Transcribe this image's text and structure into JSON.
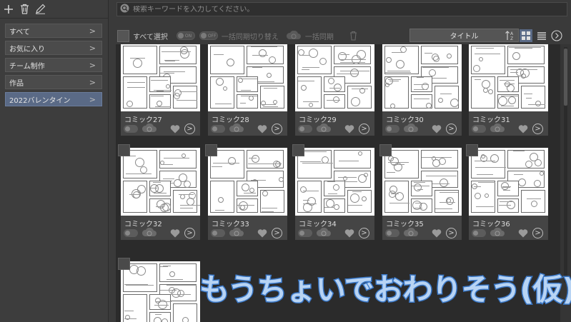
{
  "left_toolbar": {
    "icons": [
      "add-icon",
      "trash-icon",
      "pencil-icon"
    ]
  },
  "filters": [
    {
      "label": "すべて",
      "active": false
    },
    {
      "label": "お気に入り",
      "active": false
    },
    {
      "label": "チーム制作",
      "active": false
    },
    {
      "label": "作品",
      "active": false
    },
    {
      "label": "2022バレンタイン",
      "active": true
    }
  ],
  "filter_chevron": ">",
  "search": {
    "placeholder": "検索キーワードを入力してください。",
    "value": ""
  },
  "toolbar": {
    "select_all": "すべて選択",
    "toggle_on": "ON",
    "toggle_off": "OFF",
    "sync_switch": "一括同期切り替え",
    "bulk_sync": "一括同期",
    "sort": "タイトル"
  },
  "cards": [
    {
      "name": "コミック27"
    },
    {
      "name": "コミック28"
    },
    {
      "name": "コミック29"
    },
    {
      "name": "コミック30"
    },
    {
      "name": "コミック31"
    },
    {
      "name": "コミック32"
    },
    {
      "name": "コミック33"
    },
    {
      "name": "コミック34"
    },
    {
      "name": "コミック35"
    },
    {
      "name": "コミック36"
    },
    {
      "name": ""
    }
  ],
  "go_glyph": ">",
  "overlay": "もうちょいでおわりそう(仮)",
  "colors": {
    "active_filter": "#5a6a86",
    "overlay_text": "#b8d4f4",
    "overlay_stroke": "#3a78c8"
  }
}
